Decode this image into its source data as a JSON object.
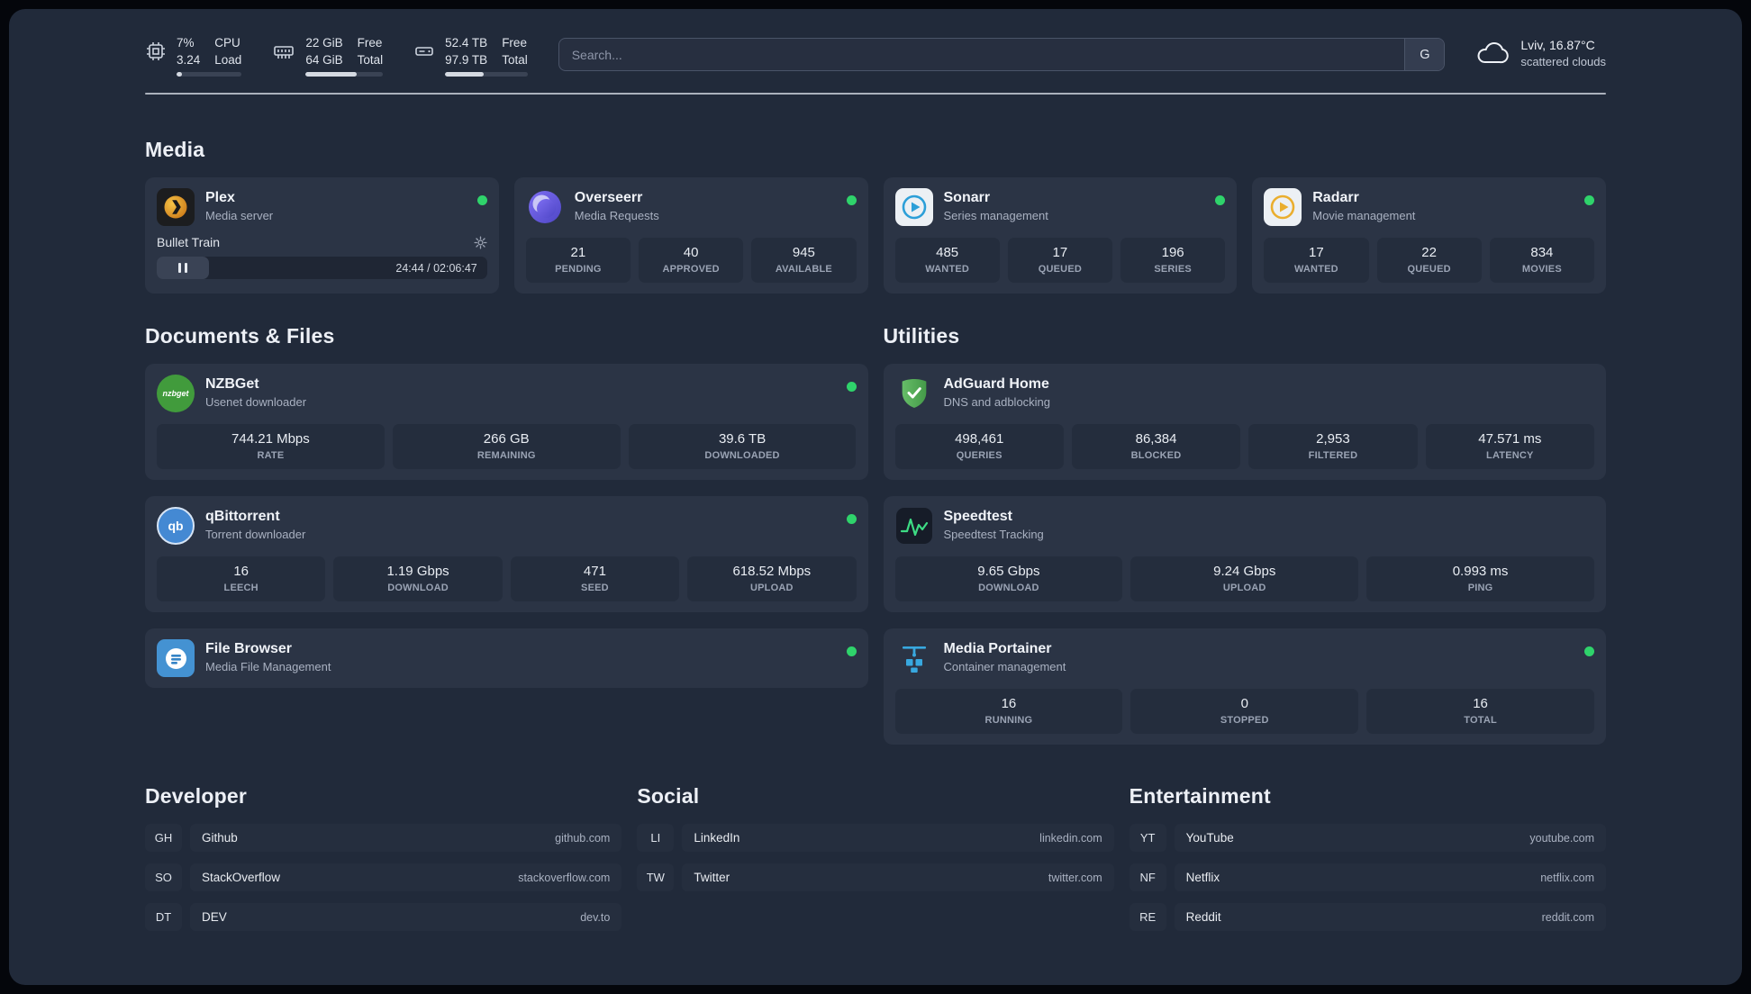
{
  "topbar": {
    "cpu": {
      "percent": "7%",
      "load": "3.24",
      "label1": "CPU",
      "label2": "Load"
    },
    "memory": {
      "free": "22 GiB",
      "total": "64 GiB",
      "label1": "Free",
      "label2": "Total"
    },
    "disk": {
      "free": "52.4 TB",
      "total": "97.9 TB",
      "label1": "Free",
      "label2": "Total"
    },
    "search": {
      "placeholder": "Search...",
      "button": "G"
    },
    "weather": {
      "location": "Lviv, 16.87°C",
      "condition": "scattered clouds"
    }
  },
  "sections": {
    "media": {
      "title": "Media",
      "plex": {
        "name": "Plex",
        "subtitle": "Media server",
        "now_playing": "Bullet Train",
        "time": "24:44 / 02:06:47"
      },
      "overseerr": {
        "name": "Overseerr",
        "subtitle": "Media Requests",
        "stats": [
          {
            "value": "21",
            "label": "PENDING"
          },
          {
            "value": "40",
            "label": "APPROVED"
          },
          {
            "value": "945",
            "label": "AVAILABLE"
          }
        ]
      },
      "sonarr": {
        "name": "Sonarr",
        "subtitle": "Series management",
        "stats": [
          {
            "value": "485",
            "label": "WANTED"
          },
          {
            "value": "17",
            "label": "QUEUED"
          },
          {
            "value": "196",
            "label": "SERIES"
          }
        ]
      },
      "radarr": {
        "name": "Radarr",
        "subtitle": "Movie management",
        "stats": [
          {
            "value": "17",
            "label": "WANTED"
          },
          {
            "value": "22",
            "label": "QUEUED"
          },
          {
            "value": "834",
            "label": "MOVIES"
          }
        ]
      }
    },
    "documents": {
      "title": "Documents & Files",
      "nzbget": {
        "name": "NZBGet",
        "subtitle": "Usenet downloader",
        "icon_text": "nzbget",
        "stats": [
          {
            "value": "744.21 Mbps",
            "label": "RATE"
          },
          {
            "value": "266 GB",
            "label": "REMAINING"
          },
          {
            "value": "39.6 TB",
            "label": "DOWNLOADED"
          }
        ]
      },
      "qbittorrent": {
        "name": "qBittorrent",
        "subtitle": "Torrent downloader",
        "icon_text": "qb",
        "stats": [
          {
            "value": "16",
            "label": "LEECH"
          },
          {
            "value": "1.19 Gbps",
            "label": "DOWNLOAD"
          },
          {
            "value": "471",
            "label": "SEED"
          },
          {
            "value": "618.52 Mbps",
            "label": "UPLOAD"
          }
        ]
      },
      "filebrowser": {
        "name": "File Browser",
        "subtitle": "Media File Management"
      }
    },
    "utilities": {
      "title": "Utilities",
      "adguard": {
        "name": "AdGuard Home",
        "subtitle": "DNS and adblocking",
        "stats": [
          {
            "value": "498,461",
            "label": "QUERIES"
          },
          {
            "value": "86,384",
            "label": "BLOCKED"
          },
          {
            "value": "2,953",
            "label": "FILTERED"
          },
          {
            "value": "47.571 ms",
            "label": "LATENCY"
          }
        ]
      },
      "speedtest": {
        "name": "Speedtest",
        "subtitle": "Speedtest Tracking",
        "stats": [
          {
            "value": "9.65 Gbps",
            "label": "DOWNLOAD"
          },
          {
            "value": "9.24 Gbps",
            "label": "UPLOAD"
          },
          {
            "value": "0.993 ms",
            "label": "PING"
          }
        ]
      },
      "portainer": {
        "name": "Media Portainer",
        "subtitle": "Container management",
        "stats": [
          {
            "value": "16",
            "label": "RUNNING"
          },
          {
            "value": "0",
            "label": "STOPPED"
          },
          {
            "value": "16",
            "label": "TOTAL"
          }
        ]
      }
    },
    "bookmarks": [
      {
        "title": "Developer",
        "links": [
          {
            "abbr": "GH",
            "name": "Github",
            "url": "github.com"
          },
          {
            "abbr": "SO",
            "name": "StackOverflow",
            "url": "stackoverflow.com"
          },
          {
            "abbr": "DT",
            "name": "DEV",
            "url": "dev.to"
          }
        ]
      },
      {
        "title": "Social",
        "links": [
          {
            "abbr": "LI",
            "name": "LinkedIn",
            "url": "linkedin.com"
          },
          {
            "abbr": "TW",
            "name": "Twitter",
            "url": "twitter.com"
          }
        ]
      },
      {
        "title": "Entertainment",
        "links": [
          {
            "abbr": "YT",
            "name": "YouTube",
            "url": "youtube.com"
          },
          {
            "abbr": "NF",
            "name": "Netflix",
            "url": "netflix.com"
          },
          {
            "abbr": "RE",
            "name": "Reddit",
            "url": "reddit.com"
          }
        ]
      }
    ]
  },
  "colors": {
    "status_online": "#2fd36b",
    "background": "#212a3a",
    "card": "#2b3445"
  }
}
